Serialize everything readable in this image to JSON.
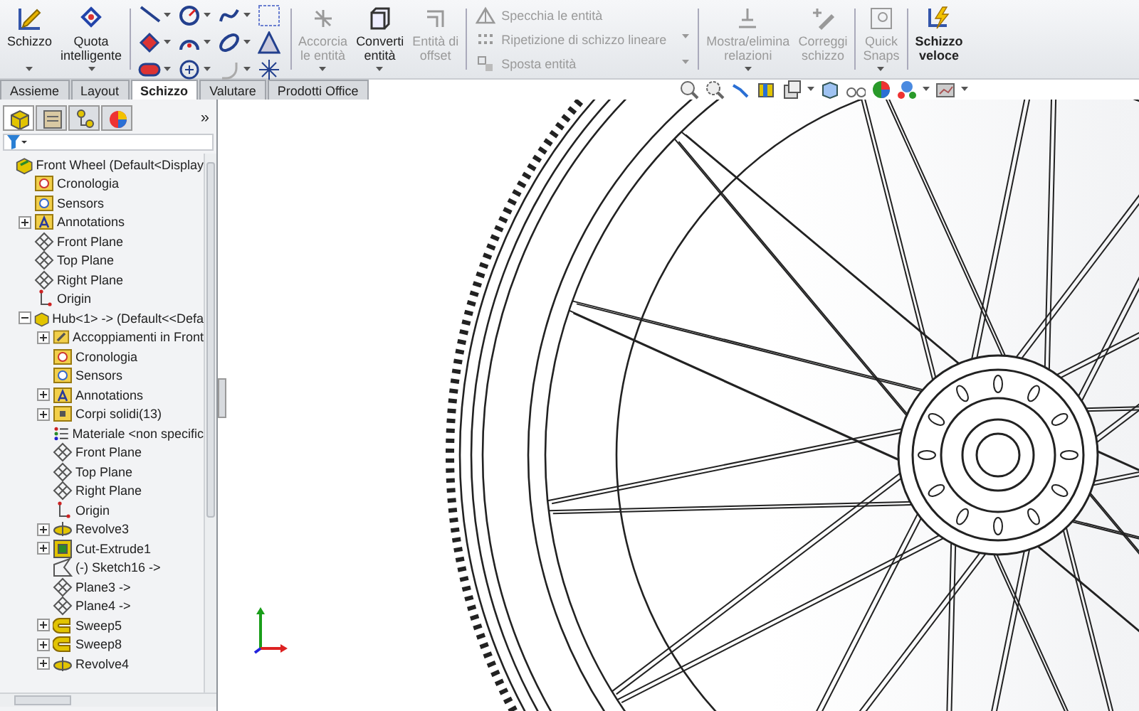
{
  "toolbar": {
    "groups": [
      {
        "kind": "large",
        "items": [
          {
            "label": "Schizzo",
            "disabled": false,
            "caret": true
          },
          {
            "label": "Quota\nintelligente",
            "disabled": false,
            "caret": true
          }
        ]
      },
      {
        "kind": "grid"
      },
      {
        "kind": "large",
        "items": [
          {
            "label": "Accorcia\nle entità",
            "disabled": true,
            "caret": true
          },
          {
            "label": "Converti\nentità",
            "disabled": false,
            "caret": true
          },
          {
            "label": "Entità di\noffset",
            "disabled": true,
            "caret": false
          }
        ]
      },
      {
        "kind": "list",
        "items": [
          {
            "label": "Specchia le entità",
            "disabled": true
          },
          {
            "label": "Ripetizione di schizzo lineare",
            "disabled": true
          },
          {
            "label": "Sposta entità",
            "disabled": true
          }
        ]
      },
      {
        "kind": "large",
        "items": [
          {
            "label": "Mostra/elimina\nrelazioni",
            "disabled": true,
            "caret": true
          },
          {
            "label": "Correggi\nschizzo",
            "disabled": true,
            "caret": false
          }
        ]
      },
      {
        "kind": "large",
        "items": [
          {
            "label": "Quick\nSnaps",
            "disabled": true,
            "caret": true
          }
        ]
      },
      {
        "kind": "large",
        "items": [
          {
            "label": "Schizzo\nveloce",
            "disabled": false,
            "caret": false
          }
        ]
      }
    ]
  },
  "tabs": [
    {
      "label": "Assieme",
      "selected": false
    },
    {
      "label": "Layout",
      "selected": false
    },
    {
      "label": "Schizzo",
      "selected": true
    },
    {
      "label": "Valutare",
      "selected": false
    },
    {
      "label": "Prodotti Office",
      "selected": false
    }
  ],
  "panel": {
    "tabs": [
      {
        "selected": true
      },
      {
        "selected": false
      },
      {
        "selected": false
      },
      {
        "selected": false
      }
    ],
    "more": "»",
    "tree": [
      {
        "label": "Front Wheel  (Default<Display",
        "kind": "assembly",
        "children": [
          {
            "label": "Cronologia",
            "kind": "history"
          },
          {
            "label": "Sensors",
            "kind": "sensor"
          },
          {
            "label": "Annotations",
            "kind": "annotation",
            "expanded": false
          },
          {
            "label": "Front Plane",
            "kind": "plane"
          },
          {
            "label": "Top Plane",
            "kind": "plane"
          },
          {
            "label": "Right Plane",
            "kind": "plane"
          },
          {
            "label": "Origin",
            "kind": "origin"
          },
          {
            "label": "Hub<1> -> (Default<<Defa",
            "kind": "part",
            "expanded": true,
            "children": [
              {
                "label": "Accoppiamenti in Front",
                "kind": "mates",
                "expanded": false
              },
              {
                "label": "Cronologia",
                "kind": "history"
              },
              {
                "label": "Sensors",
                "kind": "sensor"
              },
              {
                "label": "Annotations",
                "kind": "annotation",
                "expanded": false
              },
              {
                "label": "Corpi solidi(13)",
                "kind": "folder",
                "expanded": false
              },
              {
                "label": "Materiale <non specific",
                "kind": "material"
              },
              {
                "label": "Front Plane",
                "kind": "plane"
              },
              {
                "label": "Top Plane",
                "kind": "plane"
              },
              {
                "label": "Right Plane",
                "kind": "plane"
              },
              {
                "label": "Origin",
                "kind": "origin"
              },
              {
                "label": "Revolve3",
                "kind": "revolve",
                "expanded": false
              },
              {
                "label": "Cut-Extrude1",
                "kind": "cut",
                "expanded": false
              },
              {
                "label": "(-) Sketch16 ->",
                "kind": "sketch"
              },
              {
                "label": "Plane3 ->",
                "kind": "plane"
              },
              {
                "label": "Plane4 ->",
                "kind": "plane"
              },
              {
                "label": "Sweep5",
                "kind": "sweep",
                "expanded": false
              },
              {
                "label": "Sweep8",
                "kind": "sweep",
                "expanded": false
              },
              {
                "label": "Revolve4",
                "kind": "revolve",
                "expanded": false
              }
            ]
          }
        ]
      }
    ]
  }
}
